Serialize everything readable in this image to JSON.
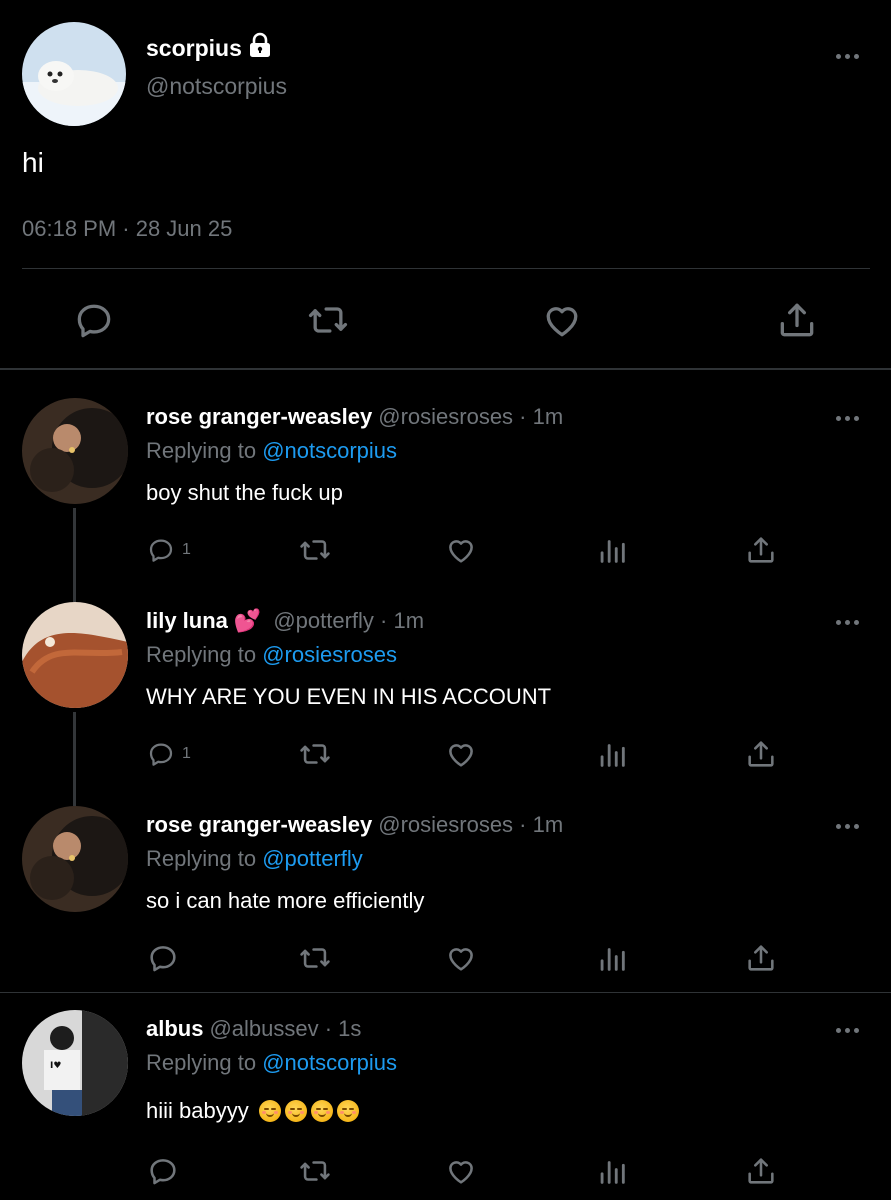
{
  "main_tweet": {
    "name": "scorpius",
    "handle": "@notscorpius",
    "text": "hi",
    "timestamp": "06:18 PM · 28 Jun 25",
    "lock_icon": "lock-icon"
  },
  "replies": [
    {
      "name": "rose granger-weasley",
      "handle_time": "@rosiesroses · 1m",
      "replying_prefix": "Replying to",
      "replying_to": "@notscorpius",
      "text": "boy shut the fuck up",
      "reply_count": "1"
    },
    {
      "name": "lily luna",
      "name_emoji": "💕",
      "handle_time": "@potterfly · 1m",
      "replying_prefix": "Replying to",
      "replying_to": "@rosiesroses",
      "text": "WHY ARE YOU EVEN IN HIS ACCOUNT",
      "reply_count": "1"
    },
    {
      "name": "rose granger-weasley",
      "handle_time": "@rosiesroses · 1m",
      "replying_prefix": "Replying to",
      "replying_to": "@potterfly",
      "text": "so i can hate more efficiently",
      "reply_count": ""
    },
    {
      "name": "albus",
      "handle_time": "@albussev · 1s",
      "replying_prefix": "Replying to",
      "replying_to": "@notscorpius",
      "text": "hiii babyyy",
      "reply_count": ""
    }
  ],
  "colors": {
    "background": "#000000",
    "text": "#e7e9ea",
    "muted": "#71767b",
    "link": "#1d9bf0",
    "divider": "#2f3336"
  }
}
